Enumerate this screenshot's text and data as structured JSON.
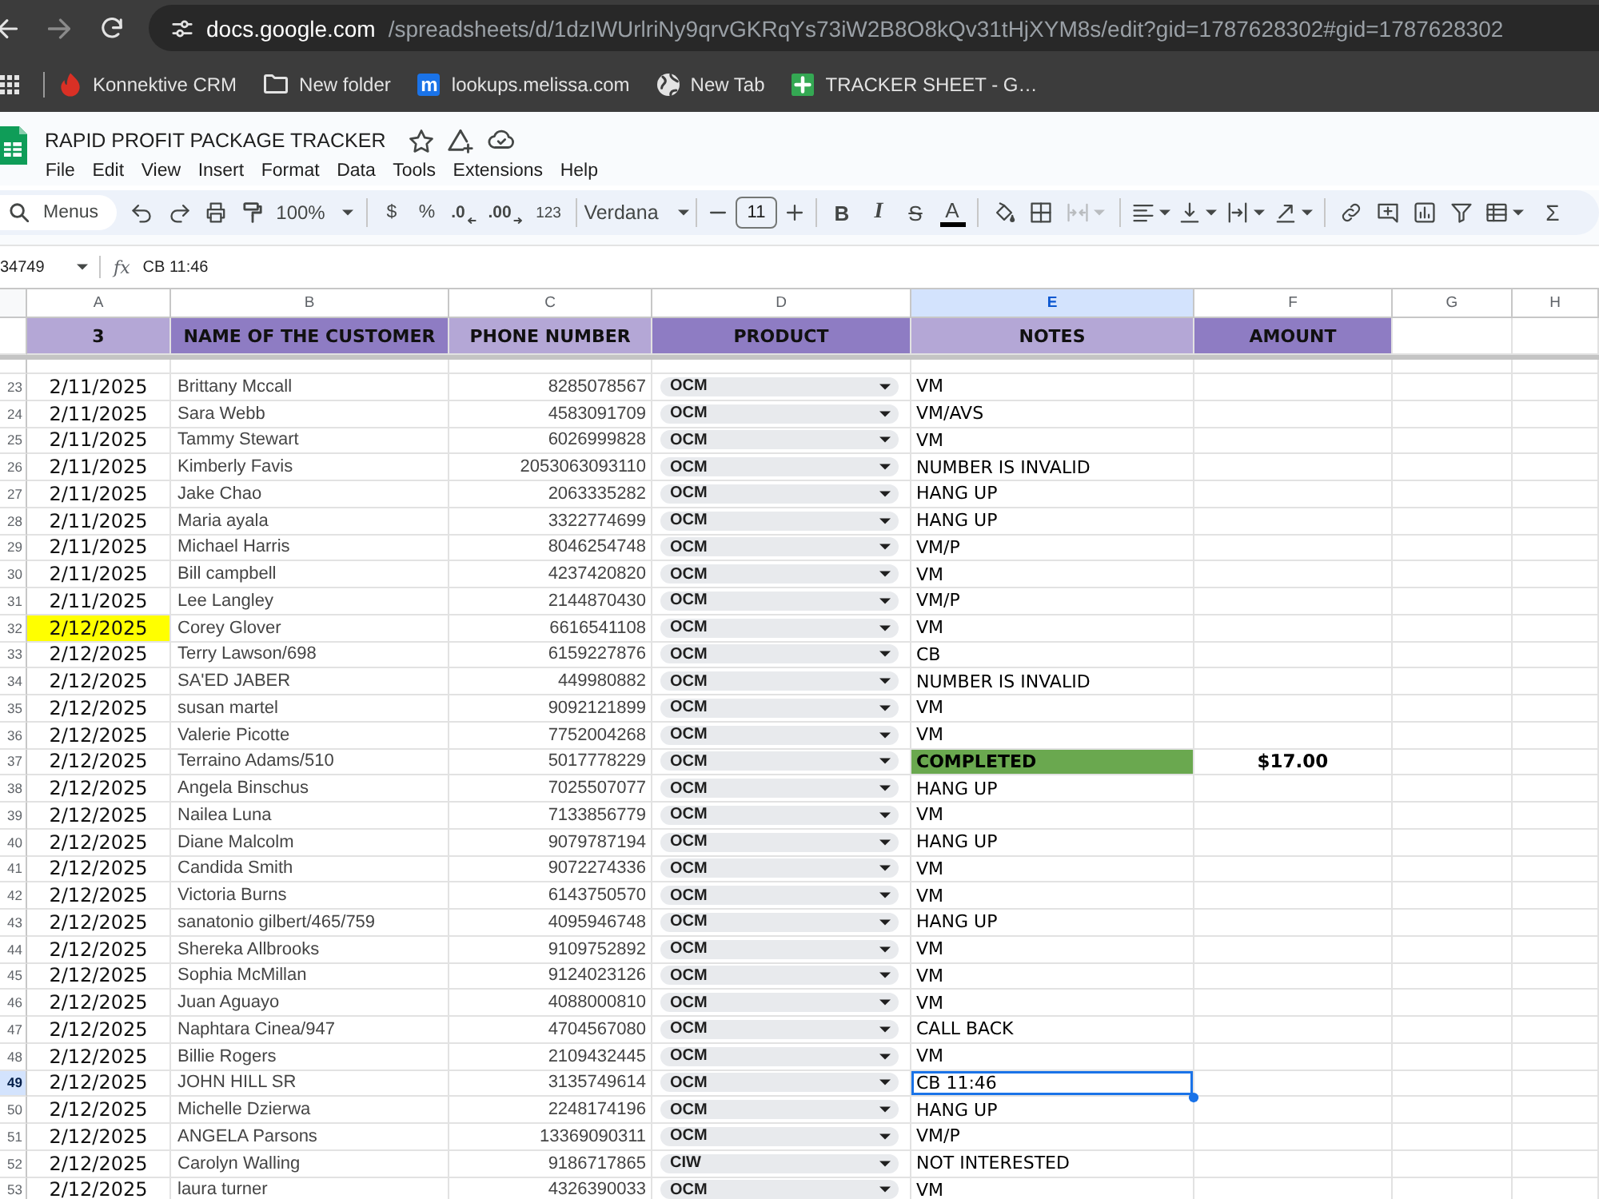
{
  "browser": {
    "address_bar": {
      "host": "docs.google.com",
      "path": "/spreadsheets/d/1dzIWUrlriNy9qrvGKRqYs73iW2B8O8kQv31tHjXYM8s/edit?gid=1787628302#gid=1787628302"
    },
    "bookmarks": [
      {
        "label": "Konnektive CRM",
        "kind": "crm"
      },
      {
        "label": "New folder",
        "kind": "folder"
      },
      {
        "label": "lookups.melissa.com",
        "kind": "letter",
        "icon_letter": "m"
      },
      {
        "label": "New Tab",
        "kind": "globe"
      },
      {
        "label": "TRACKER SHEET - G…",
        "kind": "sheets"
      }
    ]
  },
  "document": {
    "title": "RAPID PROFIT PACKAGE TRACKER",
    "menu": [
      "File",
      "Edit",
      "View",
      "Insert",
      "Format",
      "Data",
      "Tools",
      "Extensions",
      "Help"
    ]
  },
  "toolbar": {
    "search": {
      "placeholder": "Menus"
    },
    "zoom": "100%",
    "number_formats": [
      {
        "label": "$",
        "kind": "currency"
      },
      {
        "label": "%",
        "kind": "percent"
      },
      {
        "label": ".0",
        "kind": "decrease_decimals"
      },
      {
        "label": ".00",
        "kind": "increase_decimals"
      },
      {
        "label": "123",
        "kind": "number_format"
      }
    ],
    "font": "Verdana",
    "font_size": "11",
    "text_styles": [
      {
        "label": "B",
        "kind": "bold"
      },
      {
        "label": "I",
        "kind": "italic"
      },
      {
        "label": "S",
        "kind": "strikethrough"
      },
      {
        "label": "A",
        "kind": "text_color"
      }
    ],
    "merge": {
      "disabled": true
    },
    "sum": "Σ"
  },
  "formula_bar": {
    "cell_ref": "34749",
    "fx": "fx",
    "content": "CB 11:46"
  },
  "sheet": {
    "column_letters": [
      {
        "label": "A",
        "selected": false
      },
      {
        "label": "B",
        "selected": false
      },
      {
        "label": "C",
        "selected": false
      },
      {
        "label": "D",
        "selected": false
      },
      {
        "label": "E",
        "selected": true
      },
      {
        "label": "F",
        "selected": false
      },
      {
        "label": "G",
        "selected": false
      },
      {
        "label": "H",
        "selected": false
      }
    ],
    "header_cells": [
      {
        "text": "3",
        "color": "#b4a7d6"
      },
      {
        "text": "NAME OF THE CUSTOMER",
        "color": "#8e7cc3"
      },
      {
        "text": "PHONE NUMBER",
        "color": "#b4a7d6"
      },
      {
        "text": "PRODUCT",
        "color": "#8e7cc3"
      },
      {
        "text": "NOTES",
        "color": "#b4a7d6"
      },
      {
        "text": "AMOUNT",
        "color": "#8e7cc3"
      }
    ],
    "rows": [
      {
        "number": "23",
        "selected": false,
        "date": "2/11/2025",
        "date_highlighted": false,
        "name": "Brittany Mccall",
        "phone": "8285078567",
        "product": "OCM",
        "notes": "VM",
        "notes_completed": false
      },
      {
        "number": "24",
        "selected": false,
        "date": "2/11/2025",
        "date_highlighted": false,
        "name": "Sara Webb",
        "phone": "4583091709",
        "product": "OCM",
        "notes": "VM/AVS",
        "notes_completed": false
      },
      {
        "number": "25",
        "selected": false,
        "date": "2/11/2025",
        "date_highlighted": false,
        "name": "Tammy Stewart",
        "phone": "6026999828",
        "product": "OCM",
        "notes": "VM",
        "notes_completed": false
      },
      {
        "number": "26",
        "selected": false,
        "date": "2/11/2025",
        "date_highlighted": false,
        "name": "Kimberly Favis",
        "phone": "2053063093110",
        "product": "OCM",
        "notes": "NUMBER IS INVALID",
        "notes_completed": false
      },
      {
        "number": "27",
        "selected": false,
        "date": "2/11/2025",
        "date_highlighted": false,
        "name": "Jake Chao",
        "phone": "2063335282",
        "product": "OCM",
        "notes": "HANG UP",
        "notes_completed": false
      },
      {
        "number": "28",
        "selected": false,
        "date": "2/11/2025",
        "date_highlighted": false,
        "name": "Maria ayala",
        "phone": "3322774699",
        "product": "OCM",
        "notes": "HANG UP",
        "notes_completed": false
      },
      {
        "number": "29",
        "selected": false,
        "date": "2/11/2025",
        "date_highlighted": false,
        "name": "Michael Harris",
        "phone": "8046254748",
        "product": "OCM",
        "notes": "VM/P",
        "notes_completed": false
      },
      {
        "number": "30",
        "selected": false,
        "date": "2/11/2025",
        "date_highlighted": false,
        "name": "Bill campbell",
        "phone": "4237420820",
        "product": "OCM",
        "notes": "VM",
        "notes_completed": false
      },
      {
        "number": "31",
        "selected": false,
        "date": "2/11/2025",
        "date_highlighted": false,
        "name": "Lee Langley",
        "phone": "2144870430",
        "product": "OCM",
        "notes": "VM/P",
        "notes_completed": false
      },
      {
        "number": "32",
        "selected": false,
        "date": "2/12/2025",
        "date_highlighted": true,
        "name": "Corey Glover",
        "phone": "6616541108",
        "product": "OCM",
        "notes": "VM",
        "notes_completed": false
      },
      {
        "number": "33",
        "selected": false,
        "date": "2/12/2025",
        "date_highlighted": false,
        "name": "Terry Lawson/698",
        "phone": "6159227876",
        "product": "OCM",
        "notes": "CB",
        "notes_completed": false
      },
      {
        "number": "34",
        "selected": false,
        "date": "2/12/2025",
        "date_highlighted": false,
        "name": "SA'ED JABER",
        "phone": "449980882",
        "product": "OCM",
        "notes": "NUMBER IS INVALID",
        "notes_completed": false
      },
      {
        "number": "35",
        "selected": false,
        "date": "2/12/2025",
        "date_highlighted": false,
        "name": "susan martel",
        "phone": "9092121899",
        "product": "OCM",
        "notes": "VM",
        "notes_completed": false
      },
      {
        "number": "36",
        "selected": false,
        "date": "2/12/2025",
        "date_highlighted": false,
        "name": "Valerie Picotte",
        "phone": "7752004268",
        "product": "OCM",
        "notes": "VM",
        "notes_completed": false
      },
      {
        "number": "37",
        "selected": false,
        "date": "2/12/2025",
        "date_highlighted": false,
        "name": "Terraino Adams/510",
        "phone": "5017778229",
        "product": "OCM",
        "notes": "COMPLETED",
        "notes_completed": true,
        "amount": "$17.00"
      },
      {
        "number": "38",
        "selected": false,
        "date": "2/12/2025",
        "date_highlighted": false,
        "name": "Angela Binschus",
        "phone": "7025507077",
        "product": "OCM",
        "notes": "HANG UP",
        "notes_completed": false
      },
      {
        "number": "39",
        "selected": false,
        "date": "2/12/2025",
        "date_highlighted": false,
        "name": "Nailea Luna",
        "phone": "7133856779",
        "product": "OCM",
        "notes": "VM",
        "notes_completed": false
      },
      {
        "number": "40",
        "selected": false,
        "date": "2/12/2025",
        "date_highlighted": false,
        "name": "Diane Malcolm",
        "phone": "9079787194",
        "product": "OCM",
        "notes": "HANG UP",
        "notes_completed": false
      },
      {
        "number": "41",
        "selected": false,
        "date": "2/12/2025",
        "date_highlighted": false,
        "name": "Candida Smith",
        "phone": "9072274336",
        "product": "OCM",
        "notes": "VM",
        "notes_completed": false
      },
      {
        "number": "42",
        "selected": false,
        "date": "2/12/2025",
        "date_highlighted": false,
        "name": "Victoria Burns",
        "phone": "6143750570",
        "product": "OCM",
        "notes": "VM",
        "notes_completed": false
      },
      {
        "number": "43",
        "selected": false,
        "date": "2/12/2025",
        "date_highlighted": false,
        "name": "sanatonio gilbert/465/759",
        "phone": "4095946748",
        "product": "OCM",
        "notes": "HANG UP",
        "notes_completed": false
      },
      {
        "number": "44",
        "selected": false,
        "date": "2/12/2025",
        "date_highlighted": false,
        "name": "Shereka Allbrooks",
        "phone": "9109752892",
        "product": "OCM",
        "notes": "VM",
        "notes_completed": false
      },
      {
        "number": "45",
        "selected": false,
        "date": "2/12/2025",
        "date_highlighted": false,
        "name": "Sophia McMillan",
        "phone": "9124023126",
        "product": "OCM",
        "notes": "VM",
        "notes_completed": false
      },
      {
        "number": "46",
        "selected": false,
        "date": "2/12/2025",
        "date_highlighted": false,
        "name": "Juan Aguayo",
        "phone": "4088000810",
        "product": "OCM",
        "notes": "VM",
        "notes_completed": false
      },
      {
        "number": "47",
        "selected": false,
        "date": "2/12/2025",
        "date_highlighted": false,
        "name": "Naphtara Cinea/947",
        "phone": "4704567080",
        "product": "OCM",
        "notes": "CALL BACK",
        "notes_completed": false
      },
      {
        "number": "48",
        "selected": false,
        "date": "2/12/2025",
        "date_highlighted": false,
        "name": "Billie Rogers",
        "phone": "2109432445",
        "product": "OCM",
        "notes": "VM",
        "notes_completed": false
      },
      {
        "number": "49",
        "selected": true,
        "date": "2/12/2025",
        "date_highlighted": false,
        "name": "JOHN HILL SR",
        "phone": "3135749614",
        "product": "OCM",
        "notes": "CB 11:46",
        "notes_completed": false
      },
      {
        "number": "50",
        "selected": false,
        "date": "2/12/2025",
        "date_highlighted": false,
        "name": "Michelle Dzierwa",
        "phone": "2248174196",
        "product": "OCM",
        "notes": "HANG UP",
        "notes_completed": false
      },
      {
        "number": "51",
        "selected": false,
        "date": "2/12/2025",
        "date_highlighted": false,
        "name": "ANGELA Parsons",
        "phone": "13369090311",
        "product": "OCM",
        "notes": "VM/P",
        "notes_completed": false
      },
      {
        "number": "52",
        "selected": false,
        "date": "2/12/2025",
        "date_highlighted": false,
        "name": "Carolyn Walling",
        "phone": "9186717865",
        "product": "CIW",
        "notes": "NOT INTERESTED",
        "notes_completed": false
      },
      {
        "number": "53",
        "selected": false,
        "date": "2/12/2025",
        "date_highlighted": false,
        "name": "laura turner",
        "phone": "4326390033",
        "product": "OCM",
        "notes": "VM",
        "notes_completed": false
      }
    ]
  }
}
